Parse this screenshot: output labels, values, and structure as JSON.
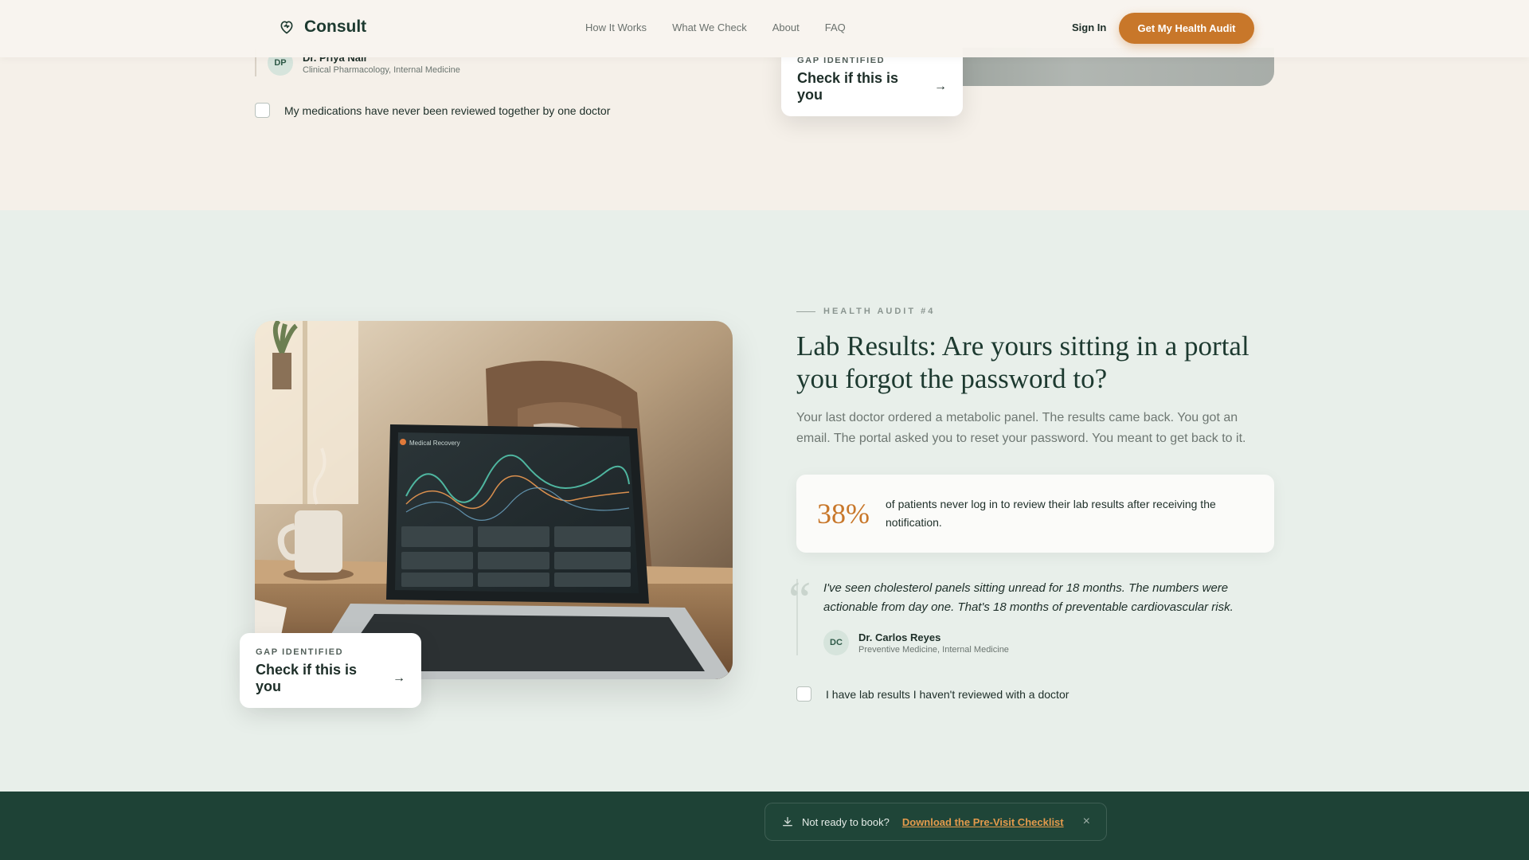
{
  "header": {
    "brand": "Consult",
    "nav": [
      "How It Works",
      "What We Check",
      "About",
      "FAQ"
    ],
    "sign_in": "Sign In",
    "cta": "Get My Health Audit"
  },
  "previous": {
    "author_initials": "DP",
    "author_name": "Dr. Priya Nair",
    "author_specialty": "Clinical Pharmacology, Internal Medicine",
    "checkbox_label": "My medications have never been reviewed together by one doctor",
    "gap_label": "GAP IDENTIFIED",
    "gap_link": "Check if this is you",
    "arrow": "→"
  },
  "audit": {
    "eyebrow": "HEALTH AUDIT #4",
    "title": "Lab Results: Are yours sitting in a portal you forgot the password to?",
    "intro": "Your last doctor ordered a metabolic panel. The results came back. You got an email. The portal asked you to reset your password. You meant to get back to it.",
    "stat_value": "38%",
    "stat_text": "of patients never log in to review their lab results after receiving the notification.",
    "quote_mark": "“",
    "quote": "I've seen cholesterol panels sitting unread for 18 months. The numbers were actionable from day one. That's 18 months of preventable cardiovascular risk.",
    "author_initials": "DC",
    "author_name": "Dr. Carlos Reyes",
    "author_specialty": "Preventive Medicine, Internal Medicine",
    "checkbox_label": "I have lab results I haven't reviewed with a doctor",
    "gap_label": "GAP IDENTIFIED",
    "gap_link": "Check if this is you",
    "arrow": "→",
    "laptop_title": "Medical Recovery"
  },
  "toast": {
    "text": "Not ready to book?",
    "link": "Download the Pre-Visit Checklist",
    "close": "×"
  },
  "colors": {
    "accent": "#c8772a",
    "dark_green": "#1e4236",
    "mint_bg": "#e8efea",
    "cream_bg": "#f5f0e9"
  },
  "icons": {
    "logo": "heart-icon",
    "download": "download-icon",
    "close": "close-icon"
  }
}
